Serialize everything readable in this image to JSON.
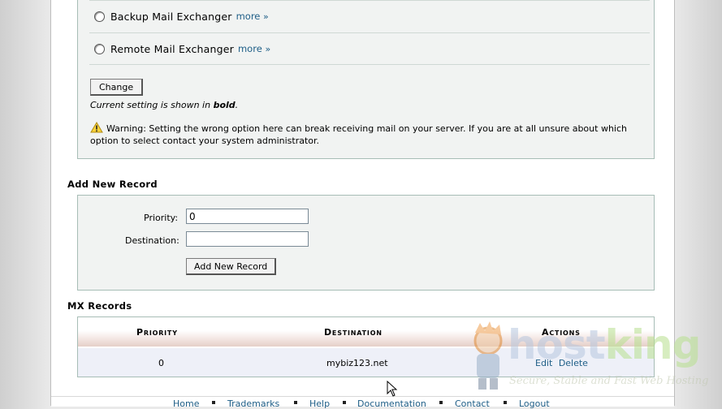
{
  "mail_exchanger": {
    "options": [
      {
        "label": "Backup Mail Exchanger",
        "more": "more",
        "raquo": "»"
      },
      {
        "label": "Remote Mail Exchanger",
        "more": "more",
        "raquo": "»"
      }
    ],
    "change_button": "Change",
    "current_note_prefix": "Current setting is shown in ",
    "current_note_bold": "bold",
    "current_note_suffix": ".",
    "warning": "Warning: Setting the wrong option here can break receiving mail on your server. If you are at all unsure about which option to select contact your system administrator."
  },
  "add_new_record": {
    "title": "Add New Record",
    "priority_label": "Priority:",
    "priority_value": "0",
    "destination_label": "Destination:",
    "destination_value": "",
    "button": "Add New Record"
  },
  "mx_records": {
    "title": "MX Records",
    "columns": [
      "Priority",
      "Destination",
      "Actions"
    ],
    "rows": [
      {
        "priority": "0",
        "destination": "mybiz123.net",
        "edit": "Edit",
        "delete": "Delete"
      }
    ]
  },
  "footer": {
    "links": [
      "Home",
      "Trademarks",
      "Help",
      "Documentation",
      "Contact",
      "Logout"
    ]
  },
  "watermark": {
    "brand_part1": "host",
    "brand_part2": "king",
    "tagline": "Secure, Stable and Fast Web Hosting"
  },
  "icons": {
    "warning": "warning-triangle-icon",
    "radio": "radio-icon",
    "cursor": "mouse-pointer-icon"
  },
  "colors": {
    "link": "#1e5e87",
    "panel_bg": "#f1f3f2",
    "panel_border": "#a7bdb6",
    "header_gradient_end": "#e5cfc8",
    "row_bg": "#eef0f8"
  }
}
